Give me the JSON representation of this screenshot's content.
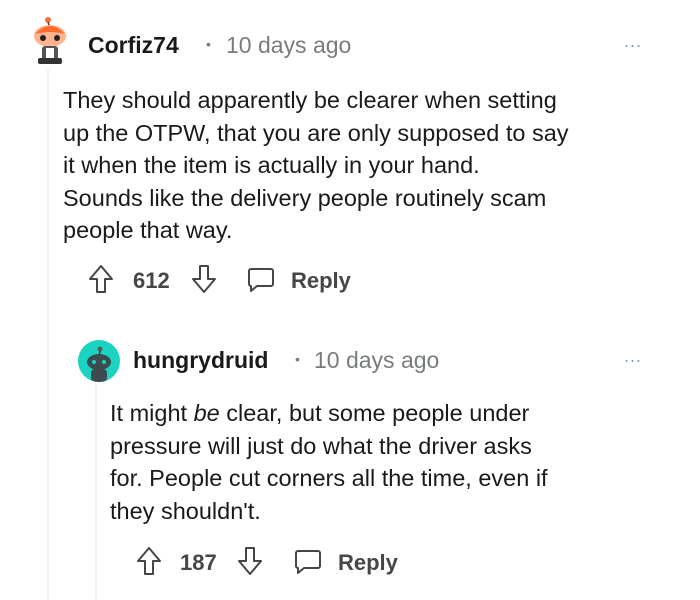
{
  "comments": [
    {
      "author": "Corfiz74",
      "separator": "•",
      "time": "10 days ago",
      "more": "...",
      "body_lines": [
        "They should apparently be clearer when setting",
        "up the OTPW, that you are only supposed to say",
        "it when the item is actually in your hand.",
        "Sounds like the delivery people routinely scam",
        "people that way."
      ],
      "score": "612",
      "reply_label": "Reply",
      "avatar_icon": "snoo-avatar-orange-icon"
    },
    {
      "author": "hungrydruid",
      "separator": "•",
      "time": "10 days ago",
      "more": "...",
      "body_parts": {
        "l1_pre": "It might ",
        "l1_em": "be",
        "l1_post": " clear, but some people under",
        "l2": "pressure will just do what the driver asks",
        "l3": "for. People cut corners all the time, even if",
        "l4": "they shouldn't."
      },
      "score": "187",
      "reply_label": "Reply",
      "avatar_icon": "snoo-avatar-teal-icon"
    }
  ],
  "colors": {
    "upvote_icon": "#454648",
    "thread_line": "#edeff1",
    "teal_avatar": "#1ad3c0",
    "orange_avatar": "#ff6b2c"
  }
}
